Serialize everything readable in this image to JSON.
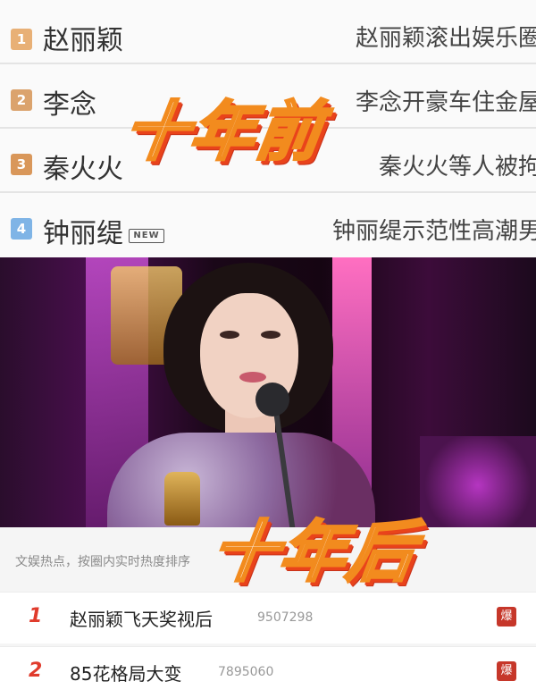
{
  "old_list": {
    "items": [
      {
        "rank": "1",
        "name": "赵丽颖",
        "headline": "赵丽颖滚出娱乐圈"
      },
      {
        "rank": "2",
        "name": "李念",
        "headline": "李念开豪车住金屋"
      },
      {
        "rank": "3",
        "name": "秦火火",
        "headline": "秦火火等人被拘"
      },
      {
        "rank": "4",
        "name": "钟丽缇",
        "headline": "钟丽缇示范性高潮男",
        "badge": "NEW"
      }
    ]
  },
  "captions": {
    "top": "十年前",
    "bottom": "十年后"
  },
  "new_list": {
    "section_title": "文娱热点，按圈内实时热度排序",
    "items": [
      {
        "rank": "1",
        "title": "赵丽颖飞天奖视后",
        "heat": "9507298",
        "badge": "爆"
      },
      {
        "rank": "2",
        "title": "85花格局大变",
        "heat": "7895060",
        "badge": "爆"
      }
    ]
  },
  "colors": {
    "rank_1": "#e8b076",
    "rank_2": "#dba36d",
    "rank_3": "#d9975a",
    "rank_4": "#7fb4e6",
    "hot_rank": "#e03b2c",
    "hot_badge": "#c6372a",
    "caption_fill": "#ffffff",
    "caption_stroke": "#f28b1e",
    "caption_shadow": "#e9431b"
  }
}
